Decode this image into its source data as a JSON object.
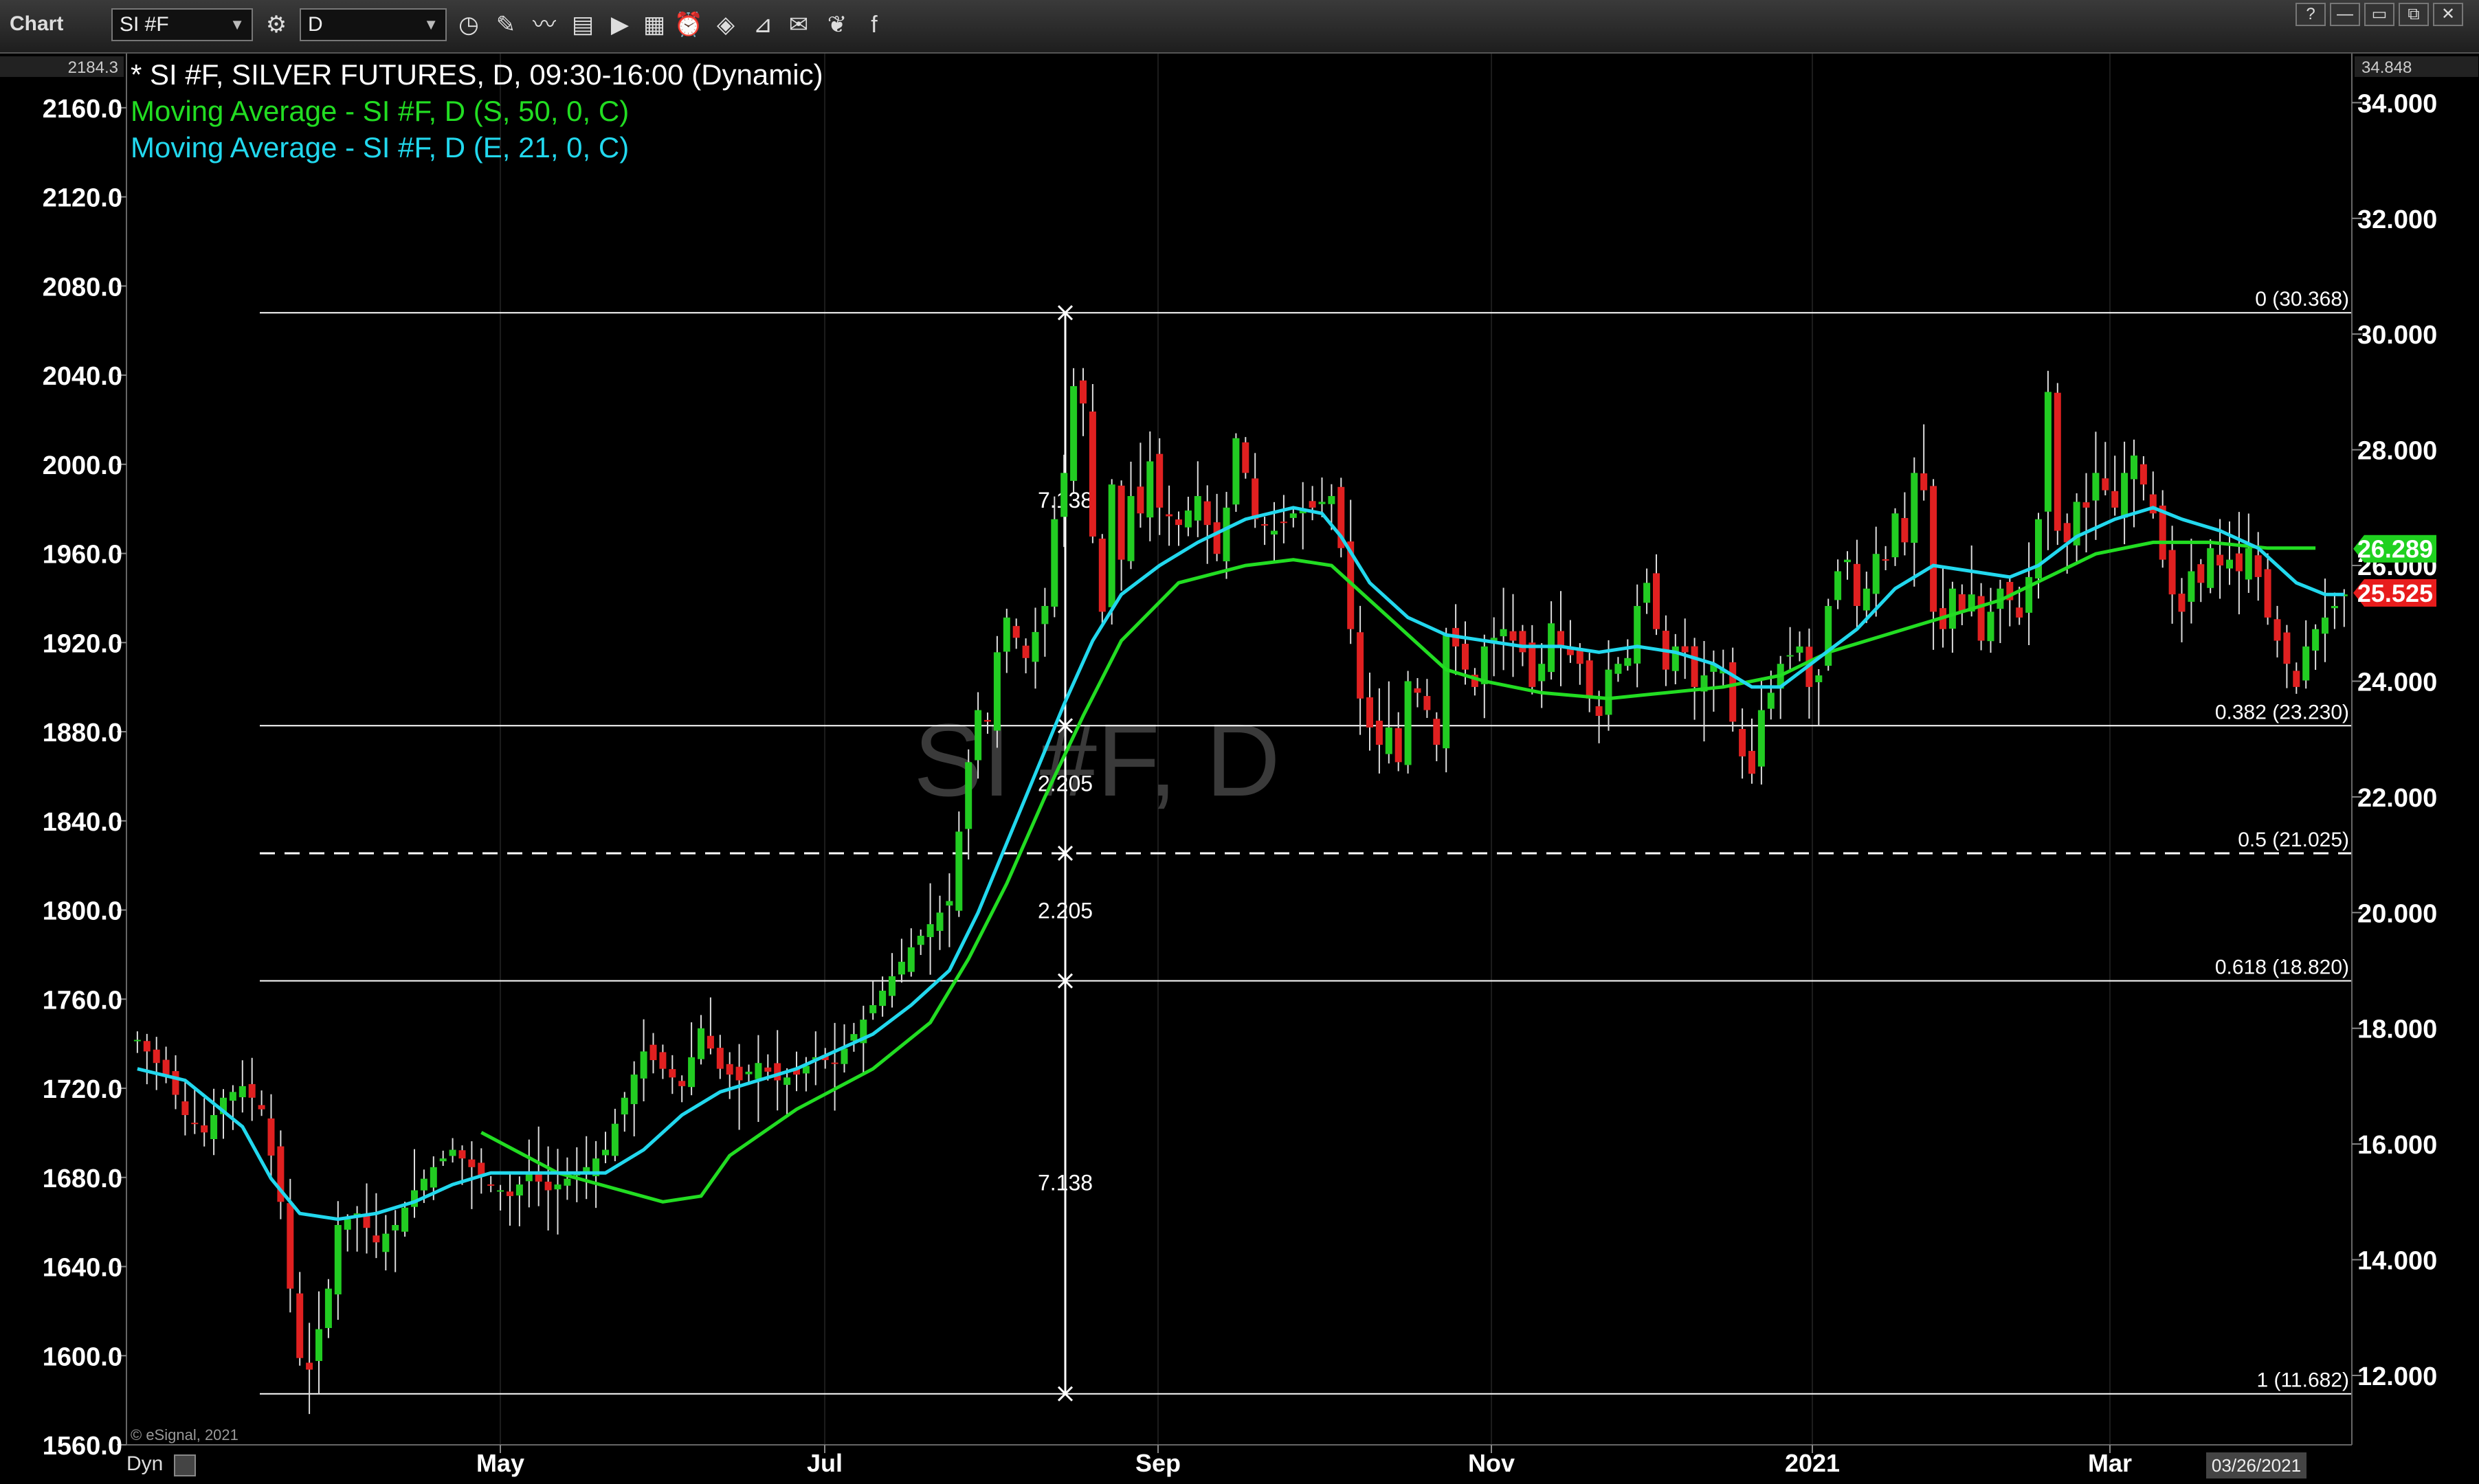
{
  "toolbar": {
    "title": "Chart",
    "symbol": "SI #F",
    "interval": "D",
    "window_buttons": [
      "?",
      "—",
      "▭",
      "⧉",
      "✕"
    ]
  },
  "legend": {
    "main": "* SI #F, SILVER FUTURES, D, 09:30-16:00 (Dynamic)",
    "ma1": "Moving Average - SI #F, D (S, 50, 0, C)",
    "ma2": "Moving Average - SI #F, D (E, 21, 0, C)"
  },
  "watermark": "SI #F, D",
  "copyright": "© eSignal, 2021",
  "bottom_left": "Dyn",
  "date_box": "03/26/2021",
  "top_left_value": "2184.3",
  "top_right_value": "34.848",
  "colors": {
    "background": "#000000",
    "up_candle": "#22cc22",
    "down_candle": "#e02020",
    "ma50": "#22dd22",
    "ema21": "#22d8ee",
    "badge_green": "#1fd11f",
    "badge_red": "#e81c1c"
  },
  "chart_data": {
    "type": "candlestick",
    "left_axis": {
      "ticks": [
        "2160.0",
        "2120.0",
        "2080.0",
        "2040.0",
        "2000.0",
        "1960.0",
        "1920.0",
        "1880.0",
        "1840.0",
        "1800.0",
        "1760.0",
        "1720.0",
        "1680.0",
        "1640.0",
        "1600.0",
        "1560.0"
      ],
      "ylim": [
        1560,
        2184.3
      ]
    },
    "right_axis": {
      "ticks": [
        "34.000",
        "32.000",
        "30.000",
        "28.000",
        "26.000",
        "24.000",
        "22.000",
        "20.000",
        "18.000",
        "16.000",
        "14.000",
        "12.000"
      ],
      "ylim": [
        10.8,
        34.848
      ]
    },
    "x_labels": [
      "May",
      "Jul",
      "Sep",
      "Nov",
      "2021",
      "Mar"
    ],
    "fib_levels": [
      {
        "label": "0 (30.368)",
        "value": 30.368
      },
      {
        "label": "0.382 (23.230)",
        "value": 23.23
      },
      {
        "label": "0.5 (21.025)",
        "value": 21.025,
        "dashed": true
      },
      {
        "label": "0.618 (18.820)",
        "value": 18.82
      },
      {
        "label": "1 (11.682)",
        "value": 11.682
      }
    ],
    "measure_labels": [
      "7.138",
      "2.205",
      "2.205",
      "7.138"
    ],
    "badges": [
      {
        "label": "26.289",
        "value": 26.289,
        "color": "green"
      },
      {
        "label": "25.525",
        "value": 25.525,
        "color": "red"
      }
    ],
    "price_path": [
      [
        1,
        17.8
      ],
      [
        4,
        17.2
      ],
      [
        6,
        16.5
      ],
      [
        8,
        16.2
      ],
      [
        10,
        16.8
      ],
      [
        12,
        17.0
      ],
      [
        14,
        16.6
      ],
      [
        16,
        15.0
      ],
      [
        17,
        13.5
      ],
      [
        18,
        12.3
      ],
      [
        19,
        12.1
      ],
      [
        20,
        12.8
      ],
      [
        21,
        13.5
      ],
      [
        22,
        14.6
      ],
      [
        24,
        14.8
      ],
      [
        26,
        14.3
      ],
      [
        28,
        14.6
      ],
      [
        30,
        15.2
      ],
      [
        32,
        15.6
      ],
      [
        34,
        15.9
      ],
      [
        36,
        15.6
      ],
      [
        38,
        15.3
      ],
      [
        40,
        15.1
      ],
      [
        42,
        15.5
      ],
      [
        44,
        15.2
      ],
      [
        46,
        15.4
      ],
      [
        48,
        15.6
      ],
      [
        50,
        15.9
      ],
      [
        52,
        16.8
      ],
      [
        54,
        17.6
      ],
      [
        56,
        17.3
      ],
      [
        58,
        17.0
      ],
      [
        60,
        18.0
      ],
      [
        62,
        17.3
      ],
      [
        64,
        17.1
      ],
      [
        66,
        17.4
      ],
      [
        68,
        17.1
      ],
      [
        70,
        17.2
      ],
      [
        72,
        17.5
      ],
      [
        74,
        17.4
      ],
      [
        76,
        17.9
      ],
      [
        78,
        18.4
      ],
      [
        80,
        18.9
      ],
      [
        82,
        19.4
      ],
      [
        84,
        19.8
      ],
      [
        86,
        20.2
      ],
      [
        87,
        21.4
      ],
      [
        88,
        22.6
      ],
      [
        89,
        23.5
      ],
      [
        90,
        23.3
      ],
      [
        91,
        24.5
      ],
      [
        92,
        25.1
      ],
      [
        94,
        24.4
      ],
      [
        96,
        25.3
      ],
      [
        97,
        26.8
      ],
      [
        98,
        27.6
      ],
      [
        99,
        29.1
      ],
      [
        100,
        28.8
      ],
      [
        101,
        26.5
      ],
      [
        102,
        25.2
      ],
      [
        103,
        27.4
      ],
      [
        104,
        26.1
      ],
      [
        105,
        27.2
      ],
      [
        106,
        26.9
      ],
      [
        107,
        27.8
      ],
      [
        108,
        27.0
      ],
      [
        110,
        26.7
      ],
      [
        112,
        27.2
      ],
      [
        114,
        26.2
      ],
      [
        115,
        27.0
      ],
      [
        116,
        28.2
      ],
      [
        117,
        27.6
      ],
      [
        118,
        26.8
      ],
      [
        120,
        26.6
      ],
      [
        122,
        26.9
      ],
      [
        124,
        27.0
      ],
      [
        126,
        27.2
      ],
      [
        127,
        26.3
      ],
      [
        128,
        24.9
      ],
      [
        129,
        23.7
      ],
      [
        130,
        23.2
      ],
      [
        131,
        22.9
      ],
      [
        132,
        23.2
      ],
      [
        133,
        22.6
      ],
      [
        134,
        24.0
      ],
      [
        135,
        23.8
      ],
      [
        136,
        23.5
      ],
      [
        137,
        22.9
      ],
      [
        138,
        24.8
      ],
      [
        139,
        24.6
      ],
      [
        140,
        24.2
      ],
      [
        141,
        23.9
      ],
      [
        142,
        24.6
      ],
      [
        144,
        24.9
      ],
      [
        146,
        24.5
      ],
      [
        147,
        23.9
      ],
      [
        148,
        24.3
      ],
      [
        149,
        25.0
      ],
      [
        150,
        24.6
      ],
      [
        152,
        24.3
      ],
      [
        153,
        23.7
      ],
      [
        154,
        23.4
      ],
      [
        155,
        24.2
      ],
      [
        157,
        24.4
      ],
      [
        158,
        25.3
      ],
      [
        159,
        25.7
      ],
      [
        160,
        24.9
      ],
      [
        161,
        24.2
      ],
      [
        162,
        24.6
      ],
      [
        163,
        24.5
      ],
      [
        164,
        23.9
      ],
      [
        166,
        24.3
      ],
      [
        167,
        24.2
      ],
      [
        168,
        23.3
      ],
      [
        169,
        22.7
      ],
      [
        170,
        22.4
      ],
      [
        171,
        23.5
      ],
      [
        172,
        23.8
      ],
      [
        173,
        24.3
      ],
      [
        175,
        24.6
      ],
      [
        176,
        23.9
      ],
      [
        177,
        24.1
      ],
      [
        178,
        25.3
      ],
      [
        179,
        25.9
      ],
      [
        180,
        26.1
      ],
      [
        181,
        25.3
      ],
      [
        182,
        25.6
      ],
      [
        183,
        26.2
      ],
      [
        184,
        26.1
      ],
      [
        185,
        26.9
      ],
      [
        186,
        26.4
      ],
      [
        187,
        27.6
      ],
      [
        188,
        27.3
      ],
      [
        189,
        25.2
      ],
      [
        190,
        24.9
      ],
      [
        191,
        25.6
      ],
      [
        192,
        25.2
      ],
      [
        193,
        25.5
      ],
      [
        194,
        24.7
      ],
      [
        195,
        25.2
      ],
      [
        196,
        25.6
      ],
      [
        197,
        25.4
      ],
      [
        198,
        25.1
      ],
      [
        199,
        25.8
      ],
      [
        200,
        26.8
      ],
      [
        201,
        29.0
      ],
      [
        202,
        26.6
      ],
      [
        203,
        26.4
      ],
      [
        204,
        27.1
      ],
      [
        205,
        27.0
      ],
      [
        206,
        27.6
      ],
      [
        207,
        27.3
      ],
      [
        208,
        27.0
      ],
      [
        209,
        27.6
      ],
      [
        210,
        27.9
      ],
      [
        211,
        27.4
      ],
      [
        212,
        26.9
      ],
      [
        213,
        26.1
      ],
      [
        214,
        25.5
      ],
      [
        215,
        25.2
      ],
      [
        216,
        25.9
      ],
      [
        217,
        25.7
      ],
      [
        218,
        26.3
      ],
      [
        219,
        26.0
      ],
      [
        220,
        26.1
      ],
      [
        221,
        25.9
      ],
      [
        222,
        26.3
      ],
      [
        223,
        25.8
      ],
      [
        224,
        25.1
      ],
      [
        225,
        24.7
      ],
      [
        226,
        24.3
      ],
      [
        227,
        23.9
      ],
      [
        228,
        24.6
      ],
      [
        229,
        24.9
      ],
      [
        230,
        25.1
      ],
      [
        231,
        25.3
      ],
      [
        232,
        25.5
      ]
    ],
    "ma50_path": [
      [
        37,
        16.2
      ],
      [
        45,
        15.5
      ],
      [
        56,
        15.0
      ],
      [
        60,
        15.1
      ],
      [
        63,
        15.8
      ],
      [
        70,
        16.6
      ],
      [
        78,
        17.3
      ],
      [
        84,
        18.1
      ],
      [
        88,
        19.2
      ],
      [
        92,
        20.5
      ],
      [
        96,
        22.0
      ],
      [
        100,
        23.4
      ],
      [
        104,
        24.7
      ],
      [
        110,
        25.7
      ],
      [
        117,
        26.0
      ],
      [
        122,
        26.1
      ],
      [
        126,
        26.0
      ],
      [
        130,
        25.4
      ],
      [
        134,
        24.8
      ],
      [
        138,
        24.2
      ],
      [
        142,
        24.0
      ],
      [
        148,
        23.8
      ],
      [
        155,
        23.7
      ],
      [
        161,
        23.8
      ],
      [
        167,
        23.9
      ],
      [
        173,
        24.1
      ],
      [
        178,
        24.5
      ],
      [
        184,
        24.8
      ],
      [
        190,
        25.1
      ],
      [
        196,
        25.4
      ],
      [
        201,
        25.8
      ],
      [
        206,
        26.2
      ],
      [
        212,
        26.4
      ],
      [
        218,
        26.4
      ],
      [
        224,
        26.3
      ],
      [
        229,
        26.3
      ]
    ],
    "ema21_path": [
      [
        1,
        17.3
      ],
      [
        6,
        17.1
      ],
      [
        12,
        16.3
      ],
      [
        15,
        15.4
      ],
      [
        18,
        14.8
      ],
      [
        22,
        14.7
      ],
      [
        26,
        14.8
      ],
      [
        30,
        15.0
      ],
      [
        34,
        15.3
      ],
      [
        38,
        15.5
      ],
      [
        42,
        15.5
      ],
      [
        47,
        15.5
      ],
      [
        50,
        15.5
      ],
      [
        54,
        15.9
      ],
      [
        58,
        16.5
      ],
      [
        62,
        16.9
      ],
      [
        66,
        17.1
      ],
      [
        70,
        17.3
      ],
      [
        74,
        17.6
      ],
      [
        78,
        17.9
      ],
      [
        82,
        18.4
      ],
      [
        86,
        19.0
      ],
      [
        89,
        20.0
      ],
      [
        92,
        21.2
      ],
      [
        95,
        22.4
      ],
      [
        98,
        23.6
      ],
      [
        101,
        24.7
      ],
      [
        104,
        25.5
      ],
      [
        108,
        26.0
      ],
      [
        112,
        26.4
      ],
      [
        117,
        26.8
      ],
      [
        122,
        27.0
      ],
      [
        125,
        26.9
      ],
      [
        127,
        26.5
      ],
      [
        130,
        25.7
      ],
      [
        134,
        25.1
      ],
      [
        138,
        24.8
      ],
      [
        142,
        24.7
      ],
      [
        146,
        24.6
      ],
      [
        150,
        24.6
      ],
      [
        154,
        24.5
      ],
      [
        158,
        24.6
      ],
      [
        162,
        24.5
      ],
      [
        166,
        24.3
      ],
      [
        170,
        23.9
      ],
      [
        173,
        23.9
      ],
      [
        177,
        24.4
      ],
      [
        181,
        24.9
      ],
      [
        185,
        25.6
      ],
      [
        189,
        26.0
      ],
      [
        193,
        25.9
      ],
      [
        197,
        25.8
      ],
      [
        200,
        26.0
      ],
      [
        204,
        26.5
      ],
      [
        208,
        26.8
      ],
      [
        212,
        27.0
      ],
      [
        215,
        26.8
      ],
      [
        219,
        26.6
      ],
      [
        223,
        26.3
      ],
      [
        227,
        25.7
      ],
      [
        230,
        25.5
      ],
      [
        232,
        25.5
      ]
    ]
  }
}
